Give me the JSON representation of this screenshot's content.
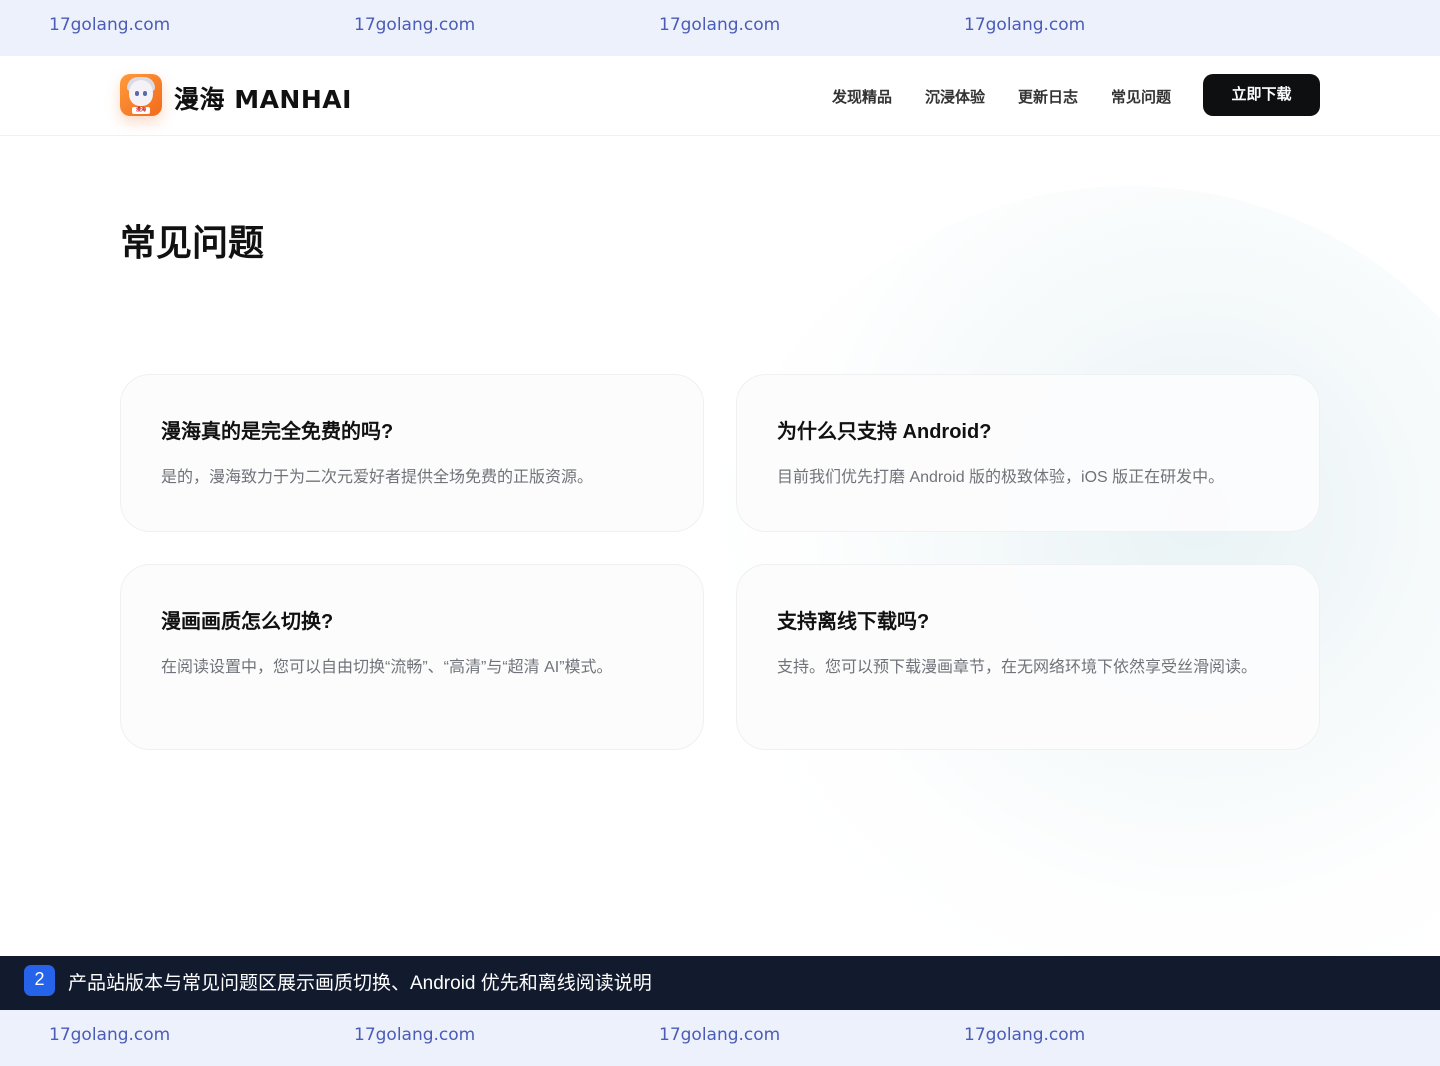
{
  "watermark": {
    "text": "17golang.com"
  },
  "header": {
    "brand": "漫海 MANHAI",
    "logo_badge_text": "漫海",
    "nav": [
      "发现精品",
      "沉浸体验",
      "更新日志",
      "常见问题"
    ],
    "download_label": "立即下载"
  },
  "faq": {
    "title": "常见问题",
    "items": [
      {
        "question": "漫海真的是完全免费的吗?",
        "answer": "是的，漫海致力于为二次元爱好者提供全场免费的正版资源。"
      },
      {
        "question": "为什么只支持 Android?",
        "answer": "目前我们优先打磨 Android 版的极致体验，iOS 版正在研发中。"
      },
      {
        "question": "漫画画质怎么切换?",
        "answer": "在阅读设置中，您可以自由切换“流畅”、“高清”与“超清 AI”模式。"
      },
      {
        "question": "支持离线下载吗?",
        "answer": "支持。您可以预下载漫画章节，在无网络环境下依然享受丝滑阅读。"
      }
    ]
  },
  "caption": {
    "badge": "2",
    "text": "产品站版本与常见问题区展示画质切换、Android 优先和离线阅读说明"
  },
  "colors": {
    "watermark_bg": "#edf1fb",
    "watermark_text": "#4a5cb6",
    "button_bg": "#0e0f11",
    "caption_bg": "#121a2e",
    "caption_badge": "#2563eb",
    "logo_orange": "#f26a1b"
  }
}
